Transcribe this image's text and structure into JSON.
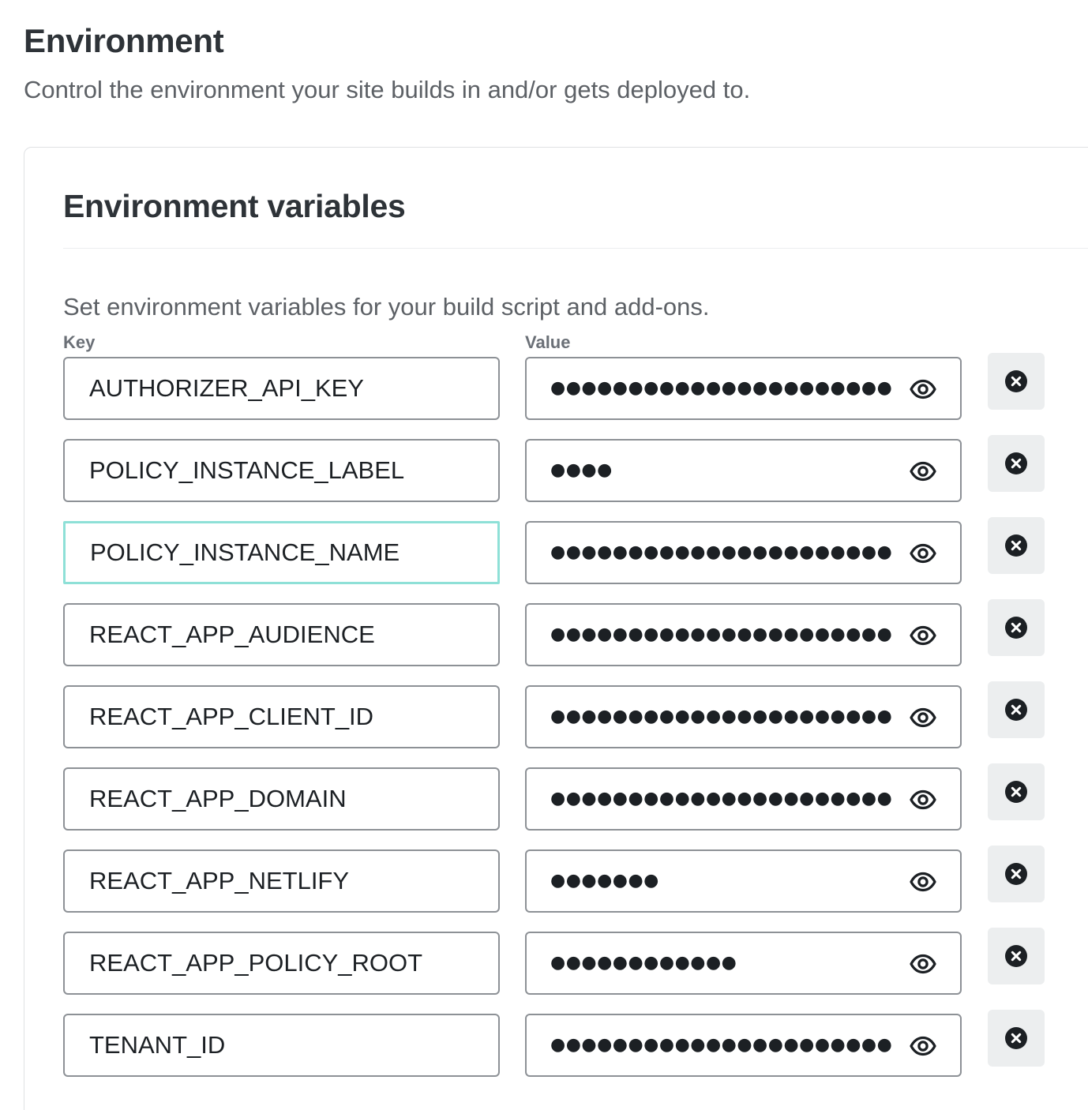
{
  "header": {
    "title": "Environment",
    "description": "Control the environment your site builds in and/or gets deployed to."
  },
  "card": {
    "title": "Environment variables",
    "description": "Set environment variables for your build script and add-ons.",
    "key_label": "Key",
    "value_label": "Value"
  },
  "icons": {
    "reveal": "eye-icon",
    "delete": "close-circle-icon"
  },
  "colors": {
    "focus_border": "#8ee0d7",
    "input_border": "#8d9196",
    "delete_bg": "#eceeef",
    "text": "#2e3338"
  },
  "variables": [
    {
      "key": "AUTHORIZER_API_KEY",
      "value_masked": "●●●●●●●●●●●●●●●●●●●●●●●●",
      "focused": false
    },
    {
      "key": "POLICY_INSTANCE_LABEL",
      "value_masked": "●●●●",
      "focused": false
    },
    {
      "key": "POLICY_INSTANCE_NAME",
      "value_masked": "●●●●●●●●●●●●●●●●●●●●●●●●",
      "focused": true
    },
    {
      "key": "REACT_APP_AUDIENCE",
      "value_masked": "●●●●●●●●●●●●●●●●●●●●●●●●",
      "focused": false
    },
    {
      "key": "REACT_APP_CLIENT_ID",
      "value_masked": "●●●●●●●●●●●●●●●●●●●●●●●●",
      "focused": false
    },
    {
      "key": "REACT_APP_DOMAIN",
      "value_masked": "●●●●●●●●●●●●●●●●●●●●●●●●",
      "focused": false
    },
    {
      "key": "REACT_APP_NETLIFY",
      "value_masked": "●●●●●●●",
      "focused": false
    },
    {
      "key": "REACT_APP_POLICY_ROOT",
      "value_masked": "●●●●●●●●●●●●",
      "focused": false
    },
    {
      "key": "TENANT_ID",
      "value_masked": "●●●●●●●●●●●●●●●●●●●●●●●●",
      "focused": false
    }
  ]
}
